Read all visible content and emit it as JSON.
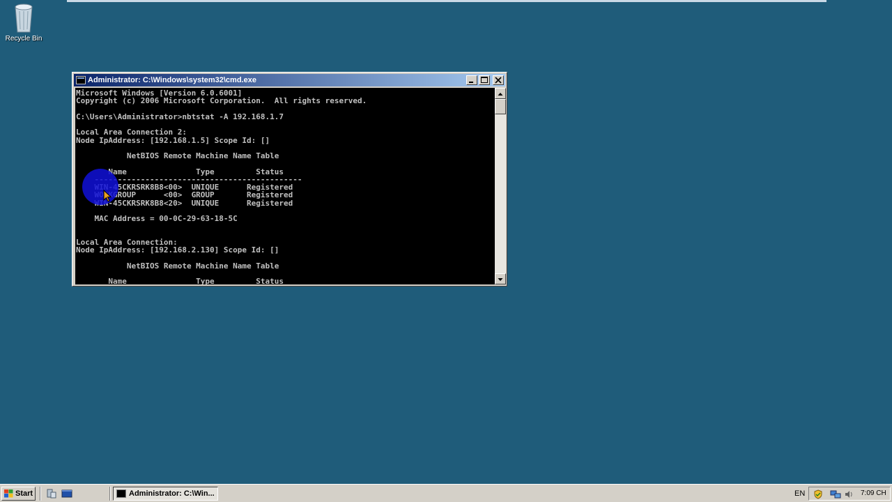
{
  "desktop": {
    "icons": [
      {
        "label": "Recycle Bin",
        "icon": "recycle-bin-icon"
      }
    ]
  },
  "window": {
    "title": "Administrator: C:\\Windows\\system32\\cmd.exe",
    "icon": "cmd-icon",
    "controls": {
      "minimize": "minimize-icon",
      "maximize": "maximize-icon",
      "close": "close-icon"
    },
    "console_lines": [
      "Microsoft Windows [Version 6.0.6001]",
      "Copyright (c) 2006 Microsoft Corporation.  All rights reserved.",
      "",
      "C:\\Users\\Administrator>nbtstat -A 192.168.1.7",
      "",
      "Local Area Connection 2:",
      "Node IpAddress: [192.168.1.5] Scope Id: []",
      "",
      "           NetBIOS Remote Machine Name Table",
      "",
      "       Name               Type         Status",
      "    ---------------------------------------------",
      "    WIN-45CKRSRK8B8<00>  UNIQUE      Registered",
      "    WORKGROUP      <00>  GROUP       Registered",
      "    WIN-45CKRSRK8B8<20>  UNIQUE      Registered",
      "",
      "    MAC Address = 00-0C-29-63-18-5C",
      "",
      "",
      "Local Area Connection:",
      "Node IpAddress: [192.168.2.130] Scope Id: []",
      "",
      "           NetBIOS Remote Machine Name Table",
      "",
      "       Name               Type         Status"
    ],
    "colors": {
      "console_bg": "#000000",
      "console_fg": "#c0c0c0",
      "title_start": "#0a246a",
      "title_end": "#a6caf0",
      "cursor_highlight": "#1010d8"
    }
  },
  "taskbar": {
    "start_label": "Start",
    "quick_launch": [
      "server-manager-icon",
      "show-desktop-icon"
    ],
    "tasks": [
      {
        "label": "Administrator: C:\\Win...",
        "icon": "cmd-icon"
      }
    ],
    "language": "EN",
    "tray_icons": [
      "shield-icon",
      "network-icon",
      "speaker-icon"
    ],
    "clock": "7:09 CH"
  },
  "colors": {
    "desktop_bg": "#1f5c7a",
    "taskbar_bg": "#d4d0c8"
  }
}
